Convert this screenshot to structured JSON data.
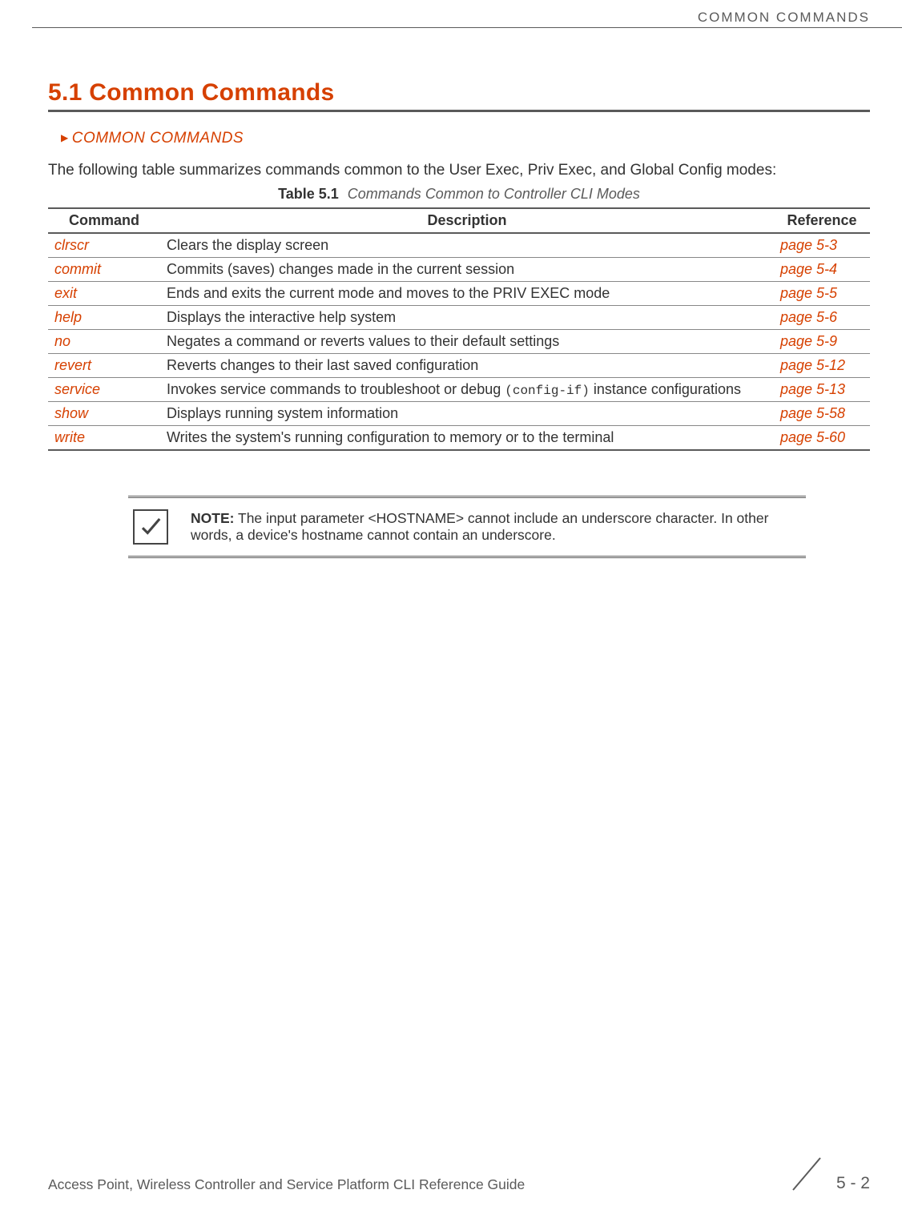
{
  "running_head": "COMMON COMMANDS",
  "section": {
    "number_title": "5.1 Common Commands"
  },
  "breadcrumb": "COMMON COMMANDS",
  "intro": "The following table summarizes commands common to the User Exec, Priv Exec, and Global Config modes:",
  "table": {
    "caption_label": "Table 5.1",
    "caption_text": "Commands Common to Controller CLI Modes",
    "headers": {
      "c1": "Command",
      "c2": "Description",
      "c3": "Reference"
    },
    "rows": [
      {
        "cmd": "clrscr",
        "desc": "Clears the display screen",
        "ref": "page 5-3"
      },
      {
        "cmd": "commit",
        "desc": "Commits (saves) changes made in the current session",
        "ref": "page 5-4"
      },
      {
        "cmd": "exit",
        "desc": "Ends and exits the current mode and moves to the PRIV EXEC mode",
        "ref": "page 5-5"
      },
      {
        "cmd": "help",
        "desc": "Displays the interactive help system",
        "ref": "page 5-6"
      },
      {
        "cmd": "no",
        "desc": "Negates a command or reverts values to their default settings",
        "ref": "page 5-9"
      },
      {
        "cmd": "revert",
        "desc": "Reverts changes to their last saved configuration",
        "ref": "page 5-12"
      },
      {
        "cmd": "service",
        "desc_pre": "Invokes service commands to troubleshoot or debug ",
        "desc_mono": "(config-if)",
        "desc_post": " instance configurations",
        "ref": "page 5-13"
      },
      {
        "cmd": "show",
        "desc": "Displays running system information",
        "ref": "page 5-58"
      },
      {
        "cmd": "write",
        "desc": "Writes the system's running configuration to memory or to the terminal",
        "ref": "page 5-60"
      }
    ]
  },
  "note": {
    "label": "NOTE:",
    "text": " The input parameter <HOSTNAME> cannot include an underscore character. In other words, a device's hostname cannot contain an underscore."
  },
  "footer": {
    "title": "Access Point, Wireless Controller and Service Platform CLI Reference Guide",
    "page": "5 - 2"
  }
}
